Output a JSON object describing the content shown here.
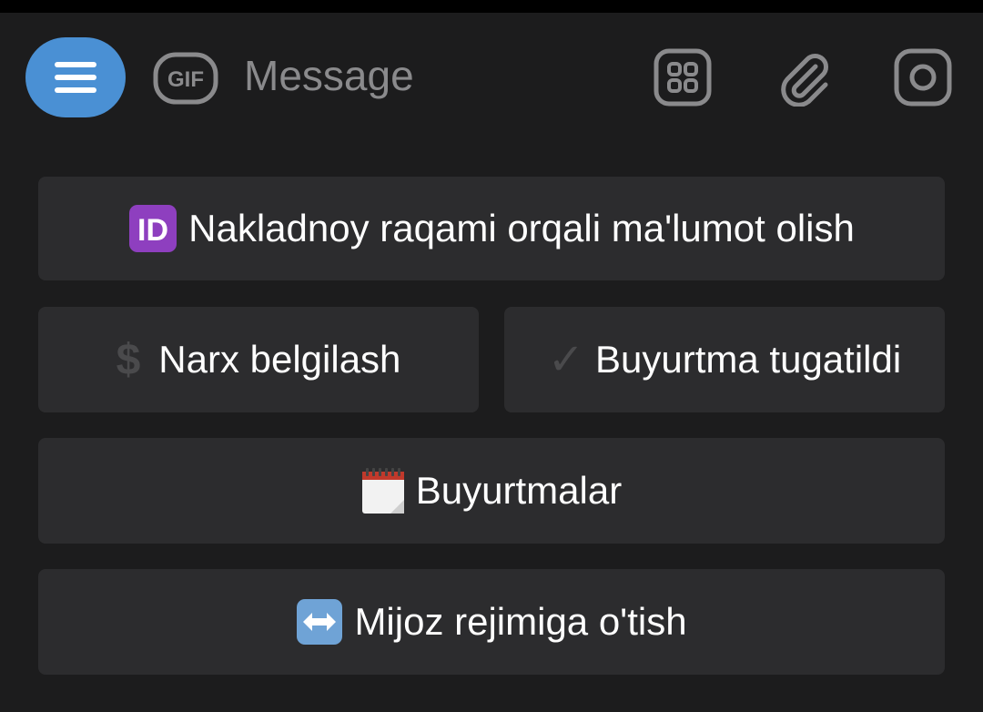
{
  "composer": {
    "message_placeholder": "Message",
    "gif_label": "GIF"
  },
  "keyboard": {
    "row1": {
      "label": "Nakladnoy raqami orqali ma'lumot olish",
      "emoji": "id-emoji",
      "badge_text": "ID"
    },
    "row2_left": {
      "label": "Narx belgilash",
      "emoji": "dollar-sign",
      "symbol": "$"
    },
    "row2_right": {
      "label": "Buyurtma tugatildi",
      "emoji": "check-mark",
      "symbol": "✓"
    },
    "row3": {
      "label": "Buyurtmalar",
      "emoji": "calendar-emoji"
    },
    "row4": {
      "label": "Mijoz rejimiga o'tish",
      "emoji": "left-right-arrow-emoji"
    }
  },
  "colors": {
    "background": "#1c1c1d",
    "button": "#2c2c2e",
    "accent": "#4a90d4",
    "icon": "#8a8a8c",
    "text": "#ffffff"
  }
}
